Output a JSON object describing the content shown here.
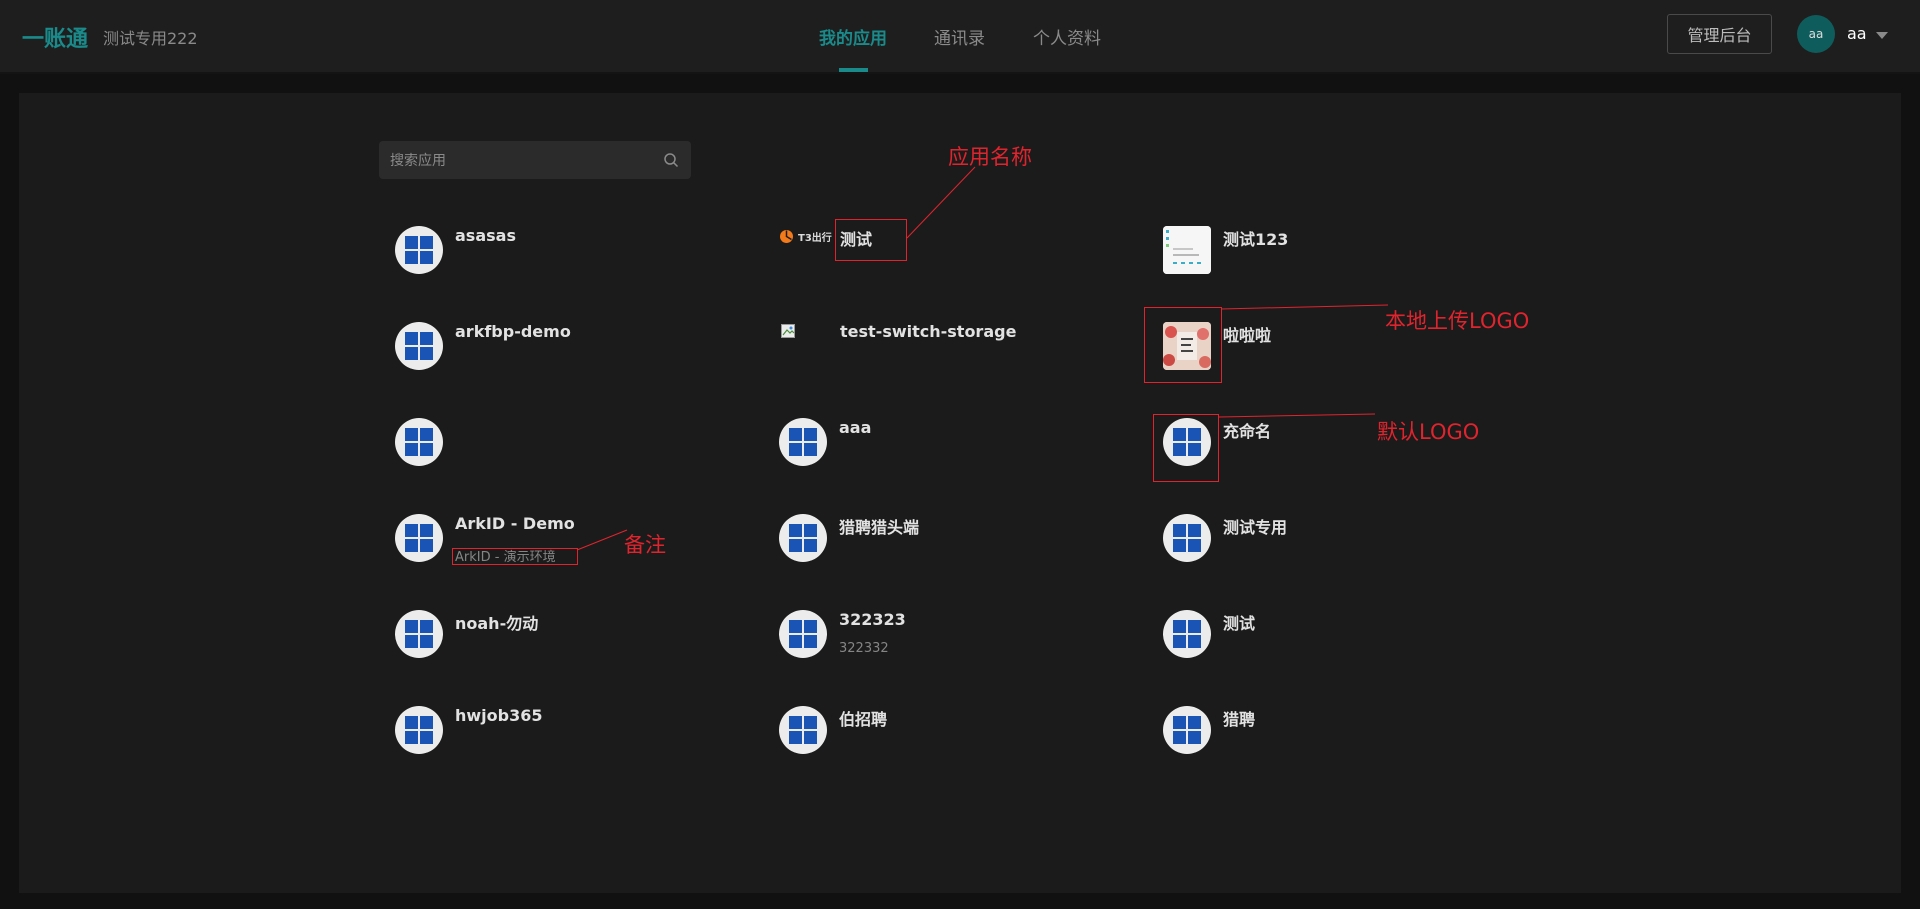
{
  "header": {
    "brand": "一账通",
    "org_name": "测试专用222",
    "nav": [
      {
        "label": "我的应用",
        "active": true
      },
      {
        "label": "通讯录",
        "active": false
      },
      {
        "label": "个人资料",
        "active": false
      }
    ],
    "admin_button": "管理后台",
    "avatar_text": "aa",
    "username": "aa"
  },
  "search": {
    "placeholder": "搜索应用",
    "value": ""
  },
  "apps": [
    {
      "name": "asasas",
      "note": "",
      "logo": "default-windows-icon"
    },
    {
      "name": "测试",
      "note": "",
      "logo": "t3-brand-logo",
      "logo_text": "T3出行"
    },
    {
      "name": "测试123",
      "note": "",
      "logo": "uploaded-image"
    },
    {
      "name": "arkfbp-demo",
      "note": "",
      "logo": "default-windows-icon"
    },
    {
      "name": "test-switch-storage",
      "note": "",
      "logo": "broken-image-icon"
    },
    {
      "name": "啦啦啦",
      "note": "",
      "logo": "uploaded-image"
    },
    {
      "name": "",
      "note": "",
      "logo": "default-windows-icon"
    },
    {
      "name": "aaa",
      "note": "",
      "logo": "default-windows-icon"
    },
    {
      "name": "充命名",
      "note": "",
      "logo": "default-windows-icon"
    },
    {
      "name": "ArkID - Demo",
      "note": "ArkID - 演示环境",
      "logo": "default-windows-icon"
    },
    {
      "name": "猎聘猎头端",
      "note": "",
      "logo": "default-windows-icon"
    },
    {
      "name": "测试专用",
      "note": "",
      "logo": "default-windows-icon"
    },
    {
      "name": "noah-勿动",
      "note": "",
      "logo": "default-windows-icon"
    },
    {
      "name": "322323",
      "note": "322332",
      "logo": "default-windows-icon"
    },
    {
      "name": "测试",
      "note": "",
      "logo": "default-windows-icon"
    },
    {
      "name": "hwjob365",
      "note": "",
      "logo": "default-windows-icon"
    },
    {
      "name": "伯招聘",
      "note": "",
      "logo": "default-windows-icon"
    },
    {
      "name": "猎聘",
      "note": "",
      "logo": "default-windows-icon"
    }
  ],
  "annotations": {
    "app_name": "应用名称",
    "local_logo": "本地上传LOGO",
    "default_logo": "默认LOGO",
    "remark": "备注"
  },
  "colors": {
    "accent": "#1a8a8a",
    "annotation": "#e0242e",
    "windows_blue": "#1a55b5"
  }
}
